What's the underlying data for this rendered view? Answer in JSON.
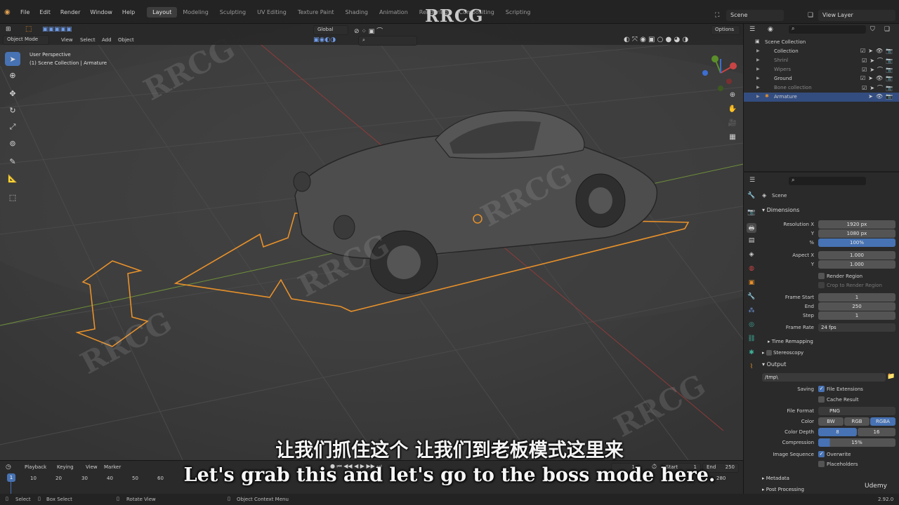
{
  "brand_watermark": "RRCG",
  "menu": [
    "File",
    "Edit",
    "Render",
    "Window",
    "Help"
  ],
  "workspaces": [
    "Layout",
    "Modeling",
    "Sculpting",
    "UV Editing",
    "Texture Paint",
    "Shading",
    "Animation",
    "Rendering",
    "Compositing",
    "Scripting"
  ],
  "scene_name": "Scene",
  "view_layer": "View Layer",
  "viewport": {
    "mode": "Object Mode",
    "menus": [
      "View",
      "Select",
      "Add",
      "Object"
    ],
    "orientation": "Global",
    "options": "Options",
    "perspective": "User Perspective",
    "context": "(1) Scene Collection | Armature"
  },
  "outliner": {
    "root": "Scene Collection",
    "items": [
      {
        "label": "Collection",
        "selected": false
      },
      {
        "label": "Shrinl",
        "selected": false
      },
      {
        "label": "Wipers",
        "selected": false
      },
      {
        "label": "Ground",
        "selected": false
      },
      {
        "label": "Bone collection",
        "selected": false
      },
      {
        "label": "Armature",
        "selected": true
      }
    ]
  },
  "properties": {
    "context": "Scene",
    "dimensions": "Dimensions",
    "res_x_label": "Resolution X",
    "res_x": "1920 px",
    "res_y_label": "Y",
    "res_y": "1080 px",
    "pct_label": "%",
    "pct": "100%",
    "aspect_x_label": "Aspect X",
    "aspect_x": "1.000",
    "aspect_y_label": "Y",
    "aspect_y": "1.000",
    "render_region": "Render Region",
    "crop_region": "Crop to Render Region",
    "frame_start_label": "Frame Start",
    "frame_start": "1",
    "end_label": "End",
    "end": "250",
    "step_label": "Step",
    "step": "1",
    "frame_rate_label": "Frame Rate",
    "frame_rate": "24 fps",
    "time_remapping": "Time Remapping",
    "stereoscopy": "Stereoscopy",
    "output": "Output",
    "output_path": "/tmp\\",
    "saving_label": "Saving",
    "file_extensions": "File Extensions",
    "cache_result": "Cache Result",
    "file_format_label": "File Format",
    "file_format": "PNG",
    "color_label": "Color",
    "color_opts": [
      "BW",
      "RGB",
      "RGBA"
    ],
    "color_depth_label": "Color Depth",
    "depth_opts": [
      "8",
      "16"
    ],
    "compression_label": "Compression",
    "compression": "15%",
    "image_sequence_label": "Image Sequence",
    "overwrite": "Overwrite",
    "placeholders": "Placeholders",
    "metadata": "Metadata",
    "post_processing": "Post Processing"
  },
  "timeline": {
    "menus": [
      "Playback",
      "Keying",
      "View",
      "Marker"
    ],
    "ticks": [
      "1",
      "10",
      "20",
      "30",
      "40",
      "50",
      "60"
    ],
    "current_frame": "1",
    "start_label": "Start",
    "start": "1",
    "end_label": "End",
    "end": "250",
    "tick_right": "280"
  },
  "statusbar": {
    "select": "Select",
    "box_select": "Box Select",
    "rotate_view": "Rotate View",
    "context_menu": "Object Context Menu",
    "version": "2.92.0"
  },
  "subtitle_cn": "让我们抓住这个 让我们到老板模式这里来",
  "subtitle_en": "Let's grab this and let's go to the boss mode here.",
  "udemy": "Udemy",
  "colors": {
    "accent": "#4772b3",
    "selection_outline": "#e8912a",
    "viewport_bg": "#3a3a3a"
  }
}
